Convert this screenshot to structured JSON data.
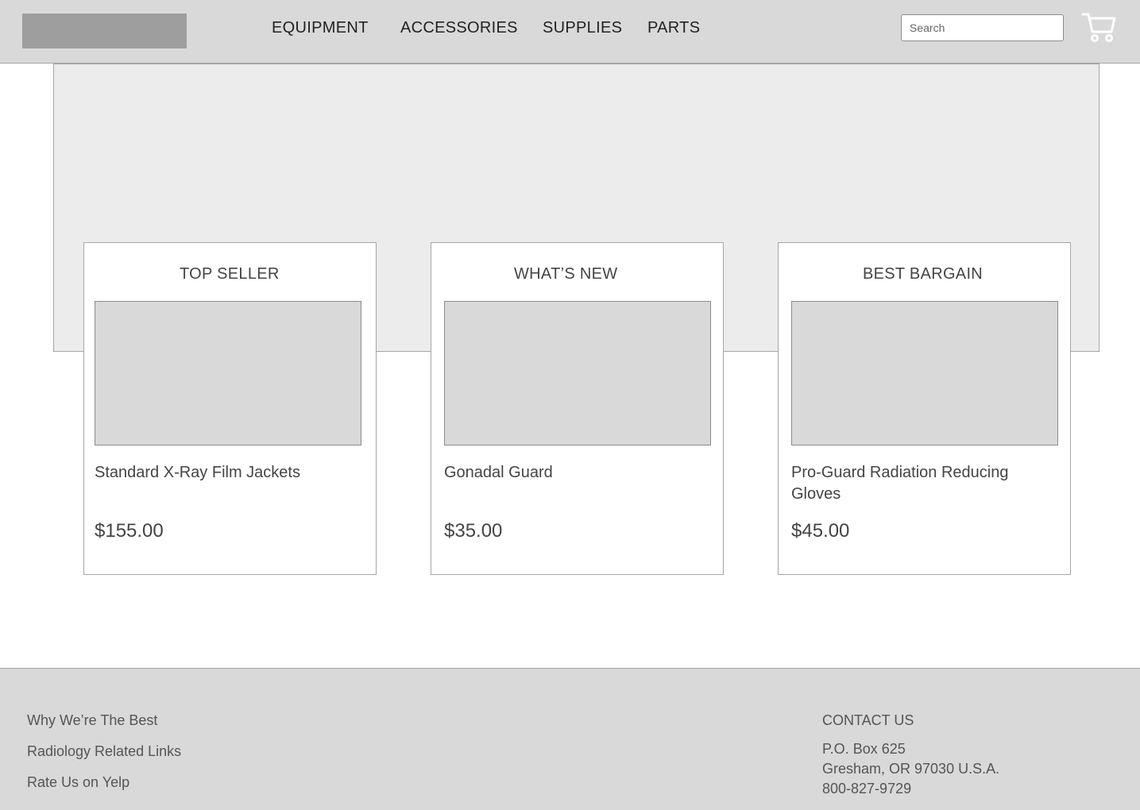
{
  "header": {
    "nav": [
      "EQUIPMENT",
      "ACCESSORIES",
      "SUPPLIES",
      "PARTS"
    ],
    "search_placeholder": "Search"
  },
  "cards": [
    {
      "heading": "TOP SELLER",
      "name": "Standard X-Ray Film Jackets",
      "price": "$155.00"
    },
    {
      "heading": "WHAT’S NEW",
      "name": "Gonadal Guard",
      "price": "$35.00"
    },
    {
      "heading": "BEST BARGAIN",
      "name": "Pro-Guard Radiation Reducing Gloves",
      "price": "$45.00"
    }
  ],
  "footer": {
    "links": [
      "Why We’re The Best",
      "Radiology Related Links",
      "Rate Us on Yelp"
    ],
    "contact_heading": "CONTACT US",
    "contact_lines": [
      "P.O. Box 625",
      "Gresham, OR 97030 U.S.A.",
      "800-827-9729"
    ]
  },
  "icons": {
    "cart": "shopping-cart-icon"
  }
}
